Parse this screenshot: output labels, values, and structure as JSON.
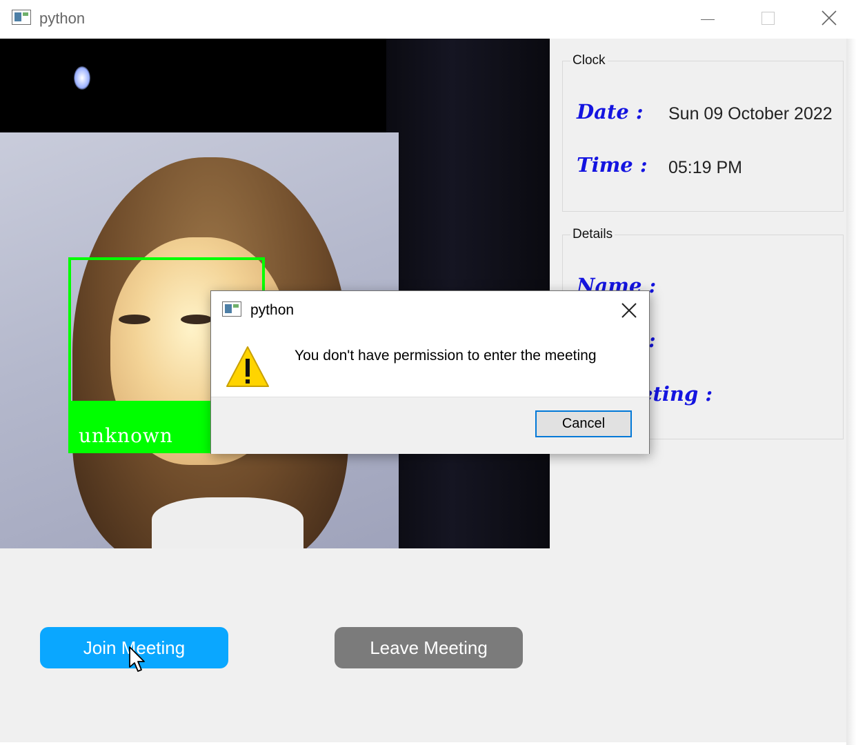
{
  "window": {
    "title": "python"
  },
  "camera": {
    "face_label": "unknown"
  },
  "clock": {
    "group_title": "Clock",
    "date_label": "Date :",
    "date_value": "Sun 09 October 2022",
    "time_label": "Time :",
    "time_value": "05:19 PM"
  },
  "details": {
    "group_title": "Details",
    "name_label": "Name :",
    "row2_label_partial": ":",
    "row3_label_partial": "eting :"
  },
  "buttons": {
    "join": "Join Meeting",
    "leave": "Leave Meeting"
  },
  "dialog": {
    "title": "python",
    "message": "You don't have  permission  to enter the meeting",
    "cancel": "Cancel"
  },
  "colors": {
    "join_button": "#0aa7ff",
    "leave_button": "#7b7b7b",
    "face_box": "#00ff00",
    "label_text": "#1414e0",
    "focus_border": "#0078d7"
  }
}
